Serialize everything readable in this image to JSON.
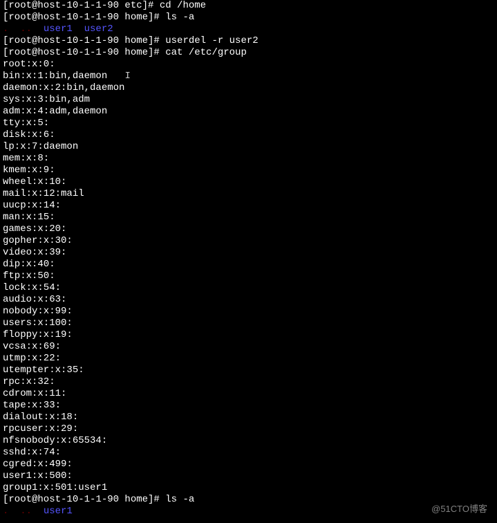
{
  "lines": [
    {
      "segments": [
        {
          "text": "[root@host-10-1-1-90 etc]# cd /home",
          "class": "white"
        }
      ]
    },
    {
      "segments": [
        {
          "text": "[root@host-10-1-1-90 home]# ls -a",
          "class": "white"
        }
      ]
    },
    {
      "segments": [
        {
          "text": ".  ..  ",
          "class": "dark-red"
        },
        {
          "text": "user1  user2",
          "class": "blue"
        }
      ]
    },
    {
      "segments": [
        {
          "text": "[root@host-10-1-1-90 home]# userdel -r user2",
          "class": "white"
        }
      ]
    },
    {
      "segments": [
        {
          "text": "[root@host-10-1-1-90 home]# cat /etc/group",
          "class": "white"
        }
      ]
    },
    {
      "segments": [
        {
          "text": "root:x:0:",
          "class": "white"
        }
      ]
    },
    {
      "segments": [
        {
          "text": "bin:x:1:bin,daemon   ",
          "class": "white"
        },
        {
          "text": "I",
          "class": "cursor"
        }
      ]
    },
    {
      "segments": [
        {
          "text": "daemon:x:2:bin,daemon",
          "class": "white"
        }
      ]
    },
    {
      "segments": [
        {
          "text": "sys:x:3:bin,adm",
          "class": "white"
        }
      ]
    },
    {
      "segments": [
        {
          "text": "adm:x:4:adm,daemon",
          "class": "white"
        }
      ]
    },
    {
      "segments": [
        {
          "text": "tty:x:5:",
          "class": "white"
        }
      ]
    },
    {
      "segments": [
        {
          "text": "disk:x:6:",
          "class": "white"
        }
      ]
    },
    {
      "segments": [
        {
          "text": "lp:x:7:daemon",
          "class": "white"
        }
      ]
    },
    {
      "segments": [
        {
          "text": "mem:x:8:",
          "class": "white"
        }
      ]
    },
    {
      "segments": [
        {
          "text": "kmem:x:9:",
          "class": "white"
        }
      ]
    },
    {
      "segments": [
        {
          "text": "wheel:x:10:",
          "class": "white"
        }
      ]
    },
    {
      "segments": [
        {
          "text": "mail:x:12:mail",
          "class": "white"
        }
      ]
    },
    {
      "segments": [
        {
          "text": "uucp:x:14:",
          "class": "white"
        }
      ]
    },
    {
      "segments": [
        {
          "text": "man:x:15:",
          "class": "white"
        }
      ]
    },
    {
      "segments": [
        {
          "text": "games:x:20:",
          "class": "white"
        }
      ]
    },
    {
      "segments": [
        {
          "text": "gopher:x:30:",
          "class": "white"
        }
      ]
    },
    {
      "segments": [
        {
          "text": "video:x:39:",
          "class": "white"
        }
      ]
    },
    {
      "segments": [
        {
          "text": "dip:x:40:",
          "class": "white"
        }
      ]
    },
    {
      "segments": [
        {
          "text": "ftp:x:50:",
          "class": "white"
        }
      ]
    },
    {
      "segments": [
        {
          "text": "lock:x:54:",
          "class": "white"
        }
      ]
    },
    {
      "segments": [
        {
          "text": "audio:x:63:",
          "class": "white"
        }
      ]
    },
    {
      "segments": [
        {
          "text": "nobody:x:99:",
          "class": "white"
        }
      ]
    },
    {
      "segments": [
        {
          "text": "users:x:100:",
          "class": "white"
        }
      ]
    },
    {
      "segments": [
        {
          "text": "floppy:x:19:",
          "class": "white"
        }
      ]
    },
    {
      "segments": [
        {
          "text": "vcsa:x:69:",
          "class": "white"
        }
      ]
    },
    {
      "segments": [
        {
          "text": "utmp:x:22:",
          "class": "white"
        }
      ]
    },
    {
      "segments": [
        {
          "text": "utempter:x:35:",
          "class": "white"
        }
      ]
    },
    {
      "segments": [
        {
          "text": "rpc:x:32:",
          "class": "white"
        }
      ]
    },
    {
      "segments": [
        {
          "text": "cdrom:x:11:",
          "class": "white"
        }
      ]
    },
    {
      "segments": [
        {
          "text": "tape:x:33:",
          "class": "white"
        }
      ]
    },
    {
      "segments": [
        {
          "text": "dialout:x:18:",
          "class": "white"
        }
      ]
    },
    {
      "segments": [
        {
          "text": "rpcuser:x:29:",
          "class": "white"
        }
      ]
    },
    {
      "segments": [
        {
          "text": "nfsnobody:x:65534:",
          "class": "white"
        }
      ]
    },
    {
      "segments": [
        {
          "text": "sshd:x:74:",
          "class": "white"
        }
      ]
    },
    {
      "segments": [
        {
          "text": "cgred:x:499:",
          "class": "white"
        }
      ]
    },
    {
      "segments": [
        {
          "text": "user1:x:500:",
          "class": "white"
        }
      ]
    },
    {
      "segments": [
        {
          "text": "group1:x:501:user1",
          "class": "white"
        }
      ]
    },
    {
      "segments": [
        {
          "text": "[root@host-10-1-1-90 home]# ls -a",
          "class": "white"
        }
      ]
    },
    {
      "segments": [
        {
          "text": ".  ..  ",
          "class": "dark-red"
        },
        {
          "text": "user1",
          "class": "blue"
        }
      ]
    }
  ],
  "watermark": "@51CTO博客"
}
